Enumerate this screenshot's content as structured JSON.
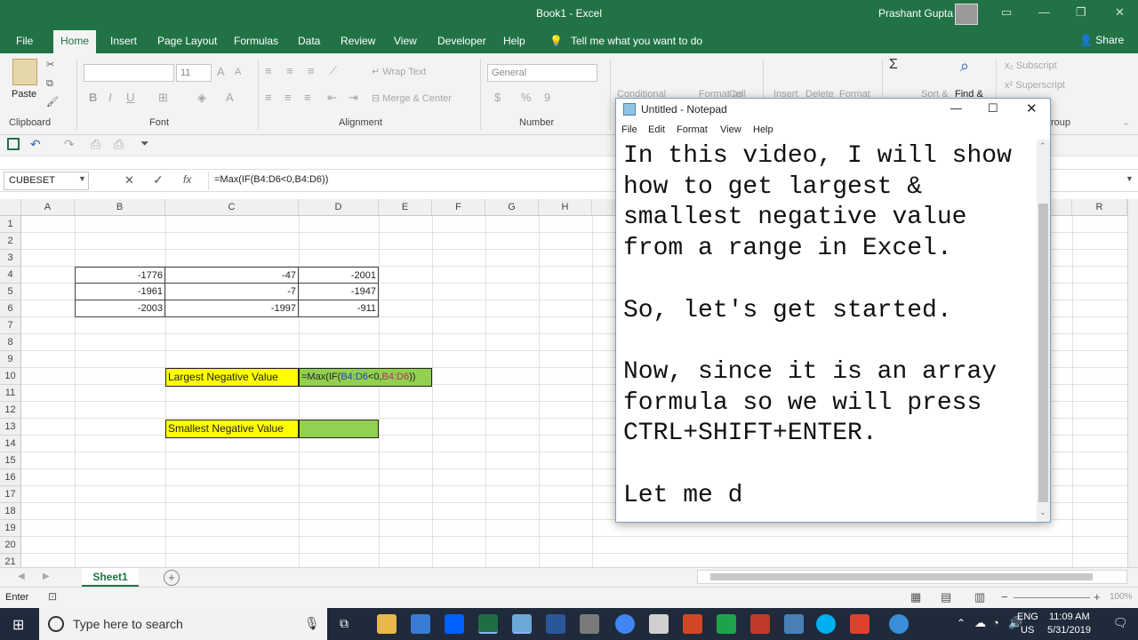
{
  "window": {
    "title": "Book1  -  Excel",
    "user": "Prashant Gupta"
  },
  "tabs": [
    "File",
    "Home",
    "Insert",
    "Page Layout",
    "Formulas",
    "Data",
    "Review",
    "View",
    "Developer",
    "Help"
  ],
  "tell_me": "Tell me what you want to do",
  "share": "Share",
  "ribbon": {
    "clipboard": {
      "paste": "Paste",
      "label": "Clipboard"
    },
    "font": {
      "size": "11",
      "label": "Font",
      "bold": "B",
      "italic": "I",
      "underline": "U"
    },
    "alignment": {
      "wrap": "Wrap Text",
      "merge": "Merge & Center",
      "label": "Alignment"
    },
    "number": {
      "format": "General",
      "currency": "$",
      "percent": "%",
      "comma": "9",
      "label": "Number"
    },
    "styles": {
      "cond": "Conditional",
      "format_as": "Format as",
      "cell": "Cell"
    },
    "cells": {
      "insert": "Insert",
      "delete": "Delete",
      "format": "Format",
      "label": "roup"
    },
    "editing": {
      "sum": "Σ",
      "sort": "Sort &",
      "find": "Find &"
    },
    "extra": {
      "subscript": "Subscript",
      "superscript": "Superscript"
    }
  },
  "formula_bar": {
    "name_box": "CUBESET",
    "formula": "=Max(IF(B4:D6<0,B4:D6))",
    "fx": "fx"
  },
  "grid": {
    "columns": [
      "A",
      "B",
      "C",
      "D",
      "E",
      "F",
      "G",
      "H",
      "R"
    ],
    "rows": [
      "1",
      "2",
      "3",
      "4",
      "5",
      "6",
      "7",
      "8",
      "9",
      "10",
      "11",
      "12",
      "13",
      "14",
      "15",
      "16",
      "17",
      "18",
      "19",
      "20",
      "21"
    ],
    "data": [
      [
        "-1776",
        "-47",
        "-2001"
      ],
      [
        "-1961",
        "-7",
        "-1947"
      ],
      [
        "-2003",
        "-1997",
        "-911"
      ]
    ],
    "largest_label": "Largest Negative Value",
    "largest_formula_start": "=Max(IF(",
    "largest_formula_ref1": "B4:D6",
    "largest_formula_mid": "<0,",
    "largest_formula_ref2": "B4:D6",
    "largest_formula_end": "))",
    "smallest_label": "Smallest Negative Value"
  },
  "sheet_tab": "Sheet1",
  "status": {
    "mode": "Enter",
    "zoom": "100%"
  },
  "notepad": {
    "title": "Untitled - Notepad",
    "menu": [
      "File",
      "Edit",
      "Format",
      "View",
      "Help"
    ],
    "lines": [
      "In this video, I will show",
      "how to get largest &",
      "smallest negative value",
      "from a range in Excel.",
      "",
      "So, let's get started.",
      "",
      "Now, since it is an array",
      "formula so we will press",
      "CTRL+SHIFT+ENTER.",
      "",
      "Let me d"
    ]
  },
  "taskbar": {
    "search_placeholder": "Type here to search",
    "lang": "ENG",
    "region": "US",
    "time": "11:09 AM",
    "date": "5/31/2019"
  }
}
